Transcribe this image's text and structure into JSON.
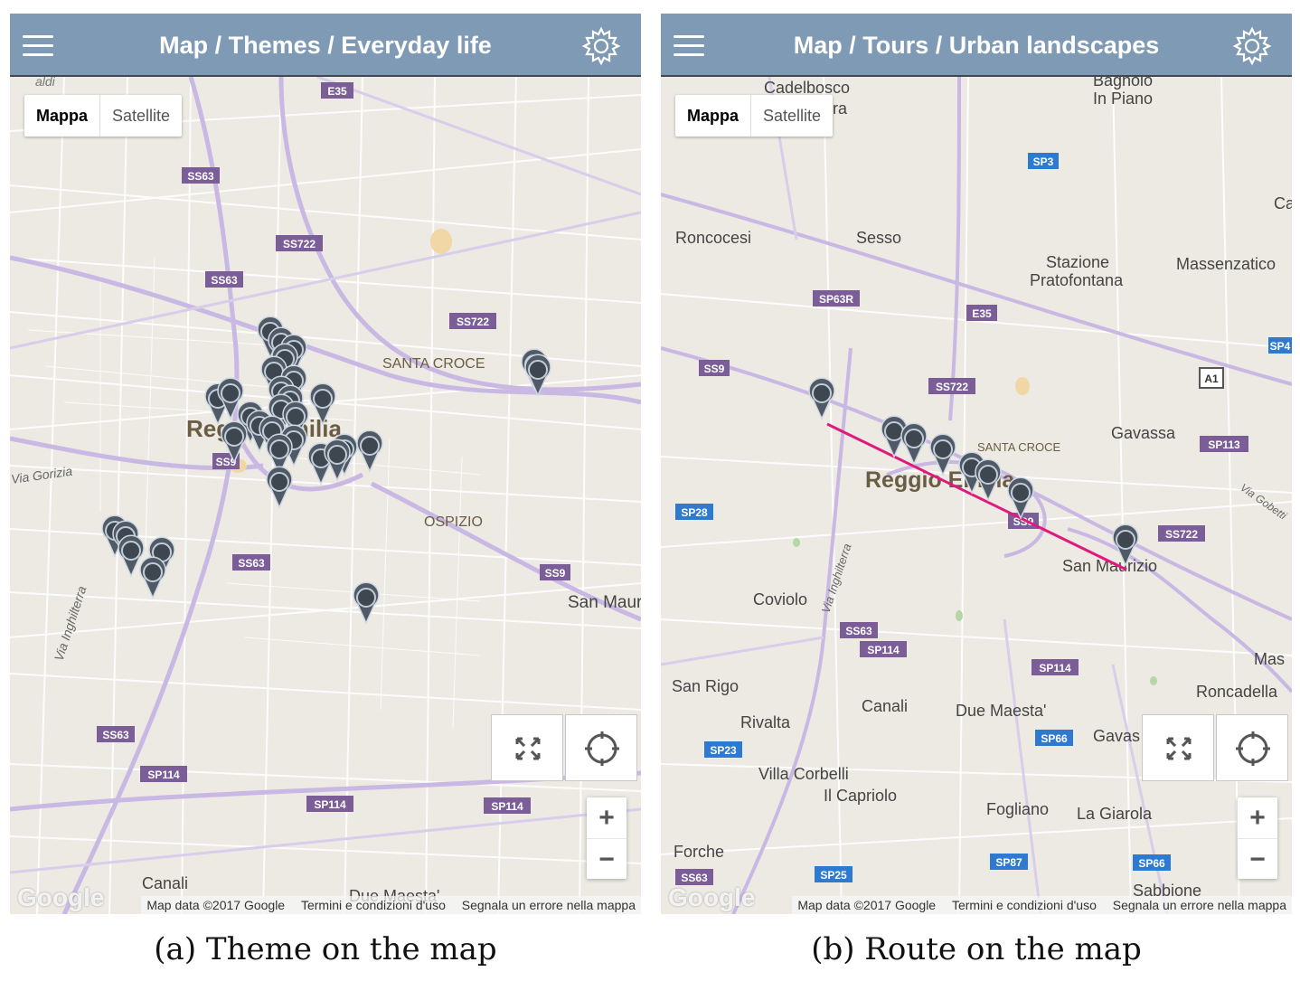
{
  "panels": [
    {
      "header": {
        "title": "Map / Themes / Everyday life",
        "menu_icon": "hamburger-menu-icon",
        "settings_icon": "gear-icon"
      },
      "map_type": {
        "map_label": "Mappa",
        "satellite_label": "Satellite",
        "selected": "Mappa"
      },
      "zoom": {
        "in": "+",
        "out": "−"
      },
      "controls": {
        "fullscreen_icon": "fullscreen-icon",
        "locate_icon": "my-location-icon"
      },
      "attribution": {
        "logo": "Google",
        "data": "Map data ©2017 Google",
        "terms": "Termini e condizioni d'uso",
        "report": "Segnala un errore nella mappa"
      },
      "place_labels": {
        "reggio": "Reggio Emilia",
        "santa_croce": "SANTA CROCE",
        "ospizio": "OSPIZIO",
        "san_maurizio": "San Maur",
        "canali": "Canali",
        "due_maesta": "Due Maesta'",
        "via_inghilterra": "Via Inghilterra",
        "via_gorizia": "Via Gorizia",
        "vialdi": "aldi"
      },
      "road_badges": [
        "E35",
        "SS63",
        "SS722",
        "SS63",
        "SS722",
        "SS9",
        "SS63",
        "SS9",
        "SS63",
        "SP114",
        "SP114",
        "SP114"
      ],
      "caption": "(a) Theme on the map"
    },
    {
      "header": {
        "title": "Map / Tours / Urban landscapes",
        "menu_icon": "hamburger-menu-icon",
        "settings_icon": "gear-icon"
      },
      "map_type": {
        "map_label": "Mappa",
        "satellite_label": "Satellite",
        "selected": "Mappa"
      },
      "zoom": {
        "in": "+",
        "out": "−"
      },
      "controls": {
        "fullscreen_icon": "fullscreen-icon",
        "locate_icon": "my-location-icon"
      },
      "attribution": {
        "logo": "Google",
        "data": "Map data ©2017 Google",
        "terms": "Termini e condizioni d'uso",
        "report": "Segnala un errore nella mappa"
      },
      "place_labels": {
        "cadelbosco": "Cadelbosco",
        "sopra": "ora",
        "bagnolo": "Bagnolo",
        "in_piano": "In Piano",
        "roncocesi": "Roncocesi",
        "sesso": "Sesso",
        "stazione": "Stazione",
        "pratofontana": "Pratofontana",
        "massenzatico": "Massenzatico",
        "ca": "Ca",
        "reggio": "Reggio Emilia",
        "santa_croce": "SANTA CROCE",
        "gavassa": "Gavassa",
        "san_maurizio": "San Maurizio",
        "coviolo": "Coviolo",
        "via_inghilterra": "Via Inghilterra",
        "san_rigo": "San Rigo",
        "canali": "Canali",
        "rivalta": "Rivalta",
        "due_maesta": "Due Maesta'",
        "gavas": "Gavas",
        "villa_corbelli": "Villa Corbelli",
        "il_capriolo": "Il Capriolo",
        "fogliano": "Fogliano",
        "la_giarola": "La Giarola",
        "forche": "Forche",
        "sabbione": "Sabbione",
        "roncadella": "Roncadella",
        "mas": "Mas",
        "via_gobetti": "Via Gobetti"
      },
      "road_badges": [
        "SP3",
        "SP63R",
        "E35",
        "SS9",
        "SS722",
        "SP28",
        "SS9",
        "SS722",
        "SP113",
        "SS63",
        "SP114",
        "SP114",
        "SP23",
        "SP66",
        "SS63",
        "SP25",
        "SP87",
        "SP66",
        "SP4",
        "A1"
      ],
      "route_color": "#e0197d",
      "caption": "(b) Route on the map"
    }
  ],
  "colors": {
    "header": "#7f9ab5",
    "map_bg": "#eceae3",
    "road_major": "#c9b8e3",
    "marker": "#505a66",
    "badge": "#7b5e98",
    "badge_sp": "#2e7ad1"
  }
}
